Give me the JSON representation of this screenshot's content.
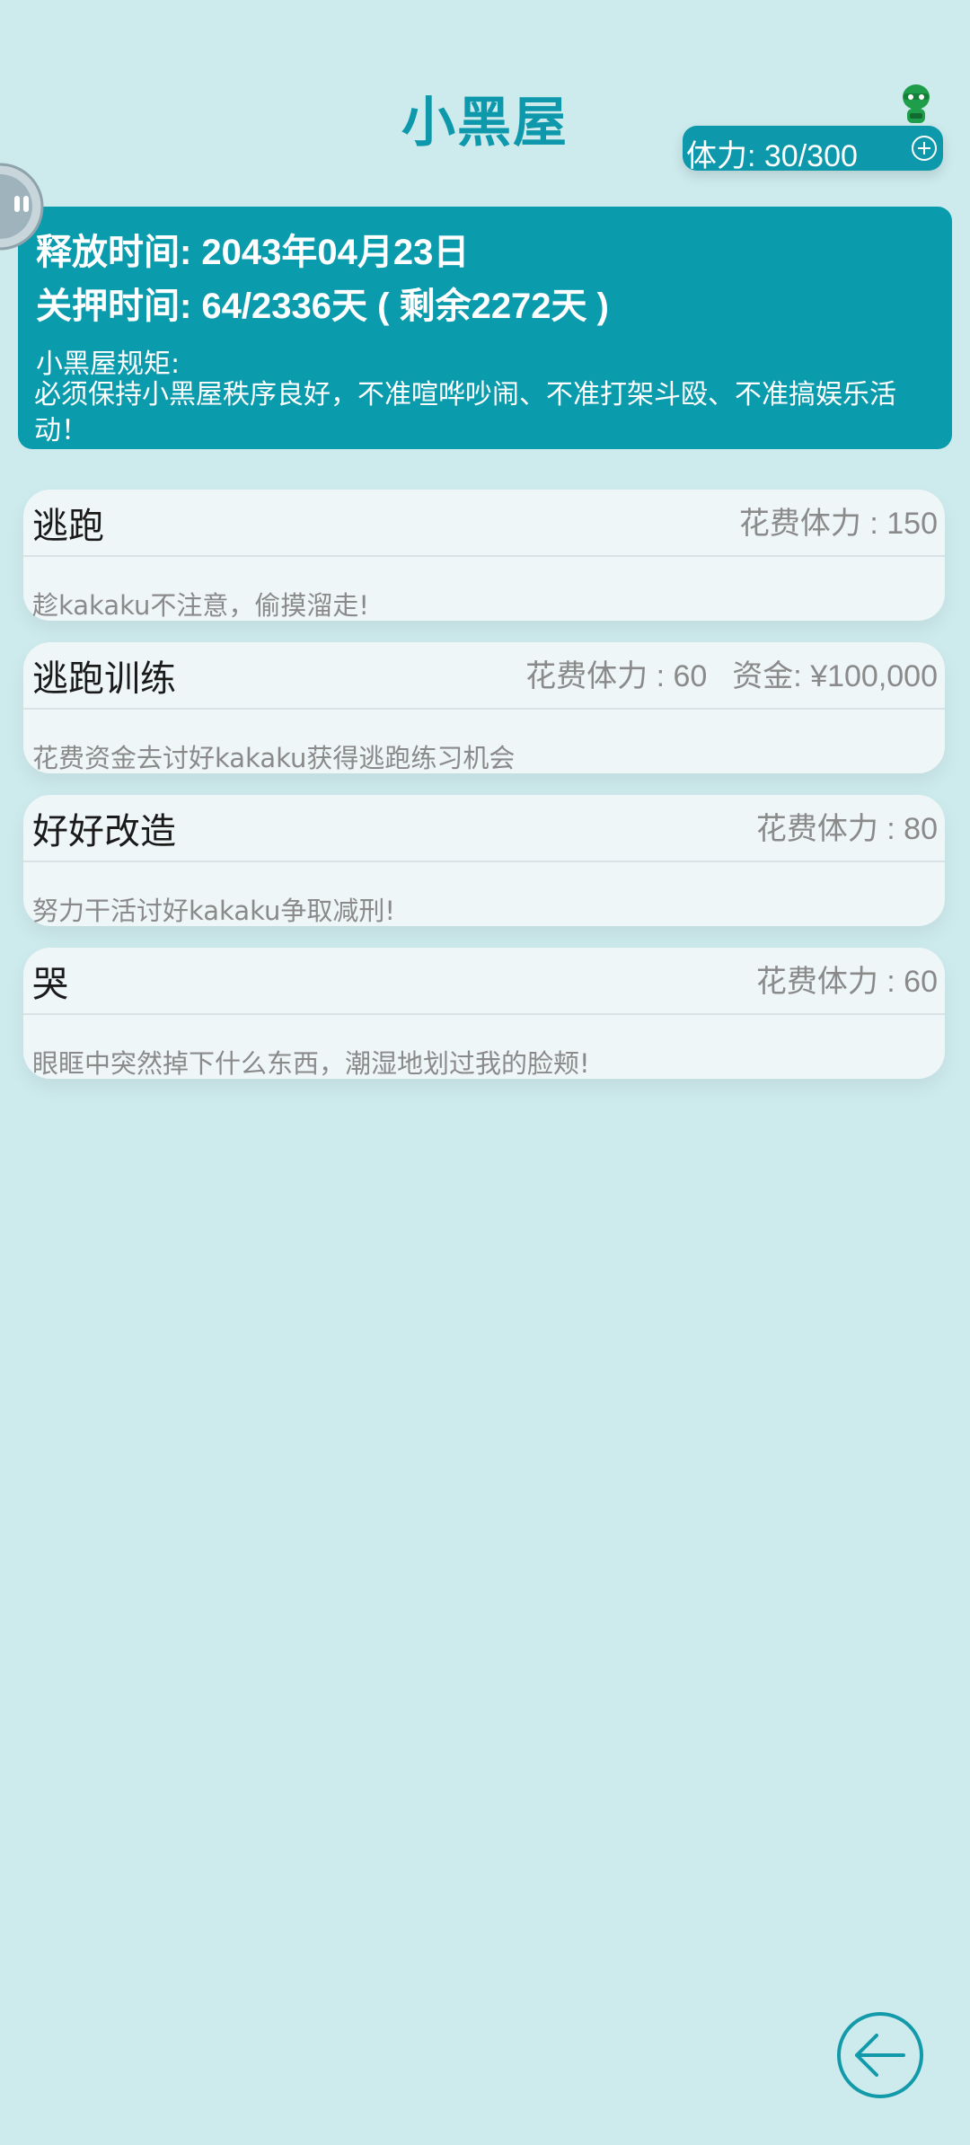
{
  "header": {
    "title": "小黑屋",
    "stamina_label": "体力: 30/300"
  },
  "info": {
    "release_time": "释放时间: 2043年04月23日",
    "detention_time": "关押时间: 64/2336天 ( 剩余2272天 )",
    "rules_title": "小黑屋规矩:",
    "rules_text": "必须保持小黑屋秩序良好，不准喧哗吵闹、不准打架斗殴、不准搞娱乐活动！"
  },
  "actions": [
    {
      "name": "逃跑",
      "cost": "花费体力 : 150",
      "funds": "",
      "description": "趁kakaku不注意，偷摸溜走!"
    },
    {
      "name": "逃跑训练",
      "cost": "花费体力 : 60",
      "funds": "资金: ¥100,000",
      "description": "花费资金去讨好kakaku获得逃跑练习机会"
    },
    {
      "name": "好好改造",
      "cost": "花费体力 : 80",
      "funds": "",
      "description": "努力干活讨好kakaku争取减刑!"
    },
    {
      "name": "哭",
      "cost": "花费体力 : 60",
      "funds": "",
      "description": "眼眶中突然掉下什么东西，潮湿地划过我的脸颊!"
    }
  ],
  "icons": {
    "plus": "plus-circle-icon",
    "mascot": "green-mascot-icon",
    "float": "floating-assist-ball-icon",
    "back": "back-arrow-icon"
  },
  "colors": {
    "background": "#cdeaec",
    "accent": "#0d99ab",
    "card": "#eff6f8",
    "muted_text": "#8a8a8a"
  }
}
